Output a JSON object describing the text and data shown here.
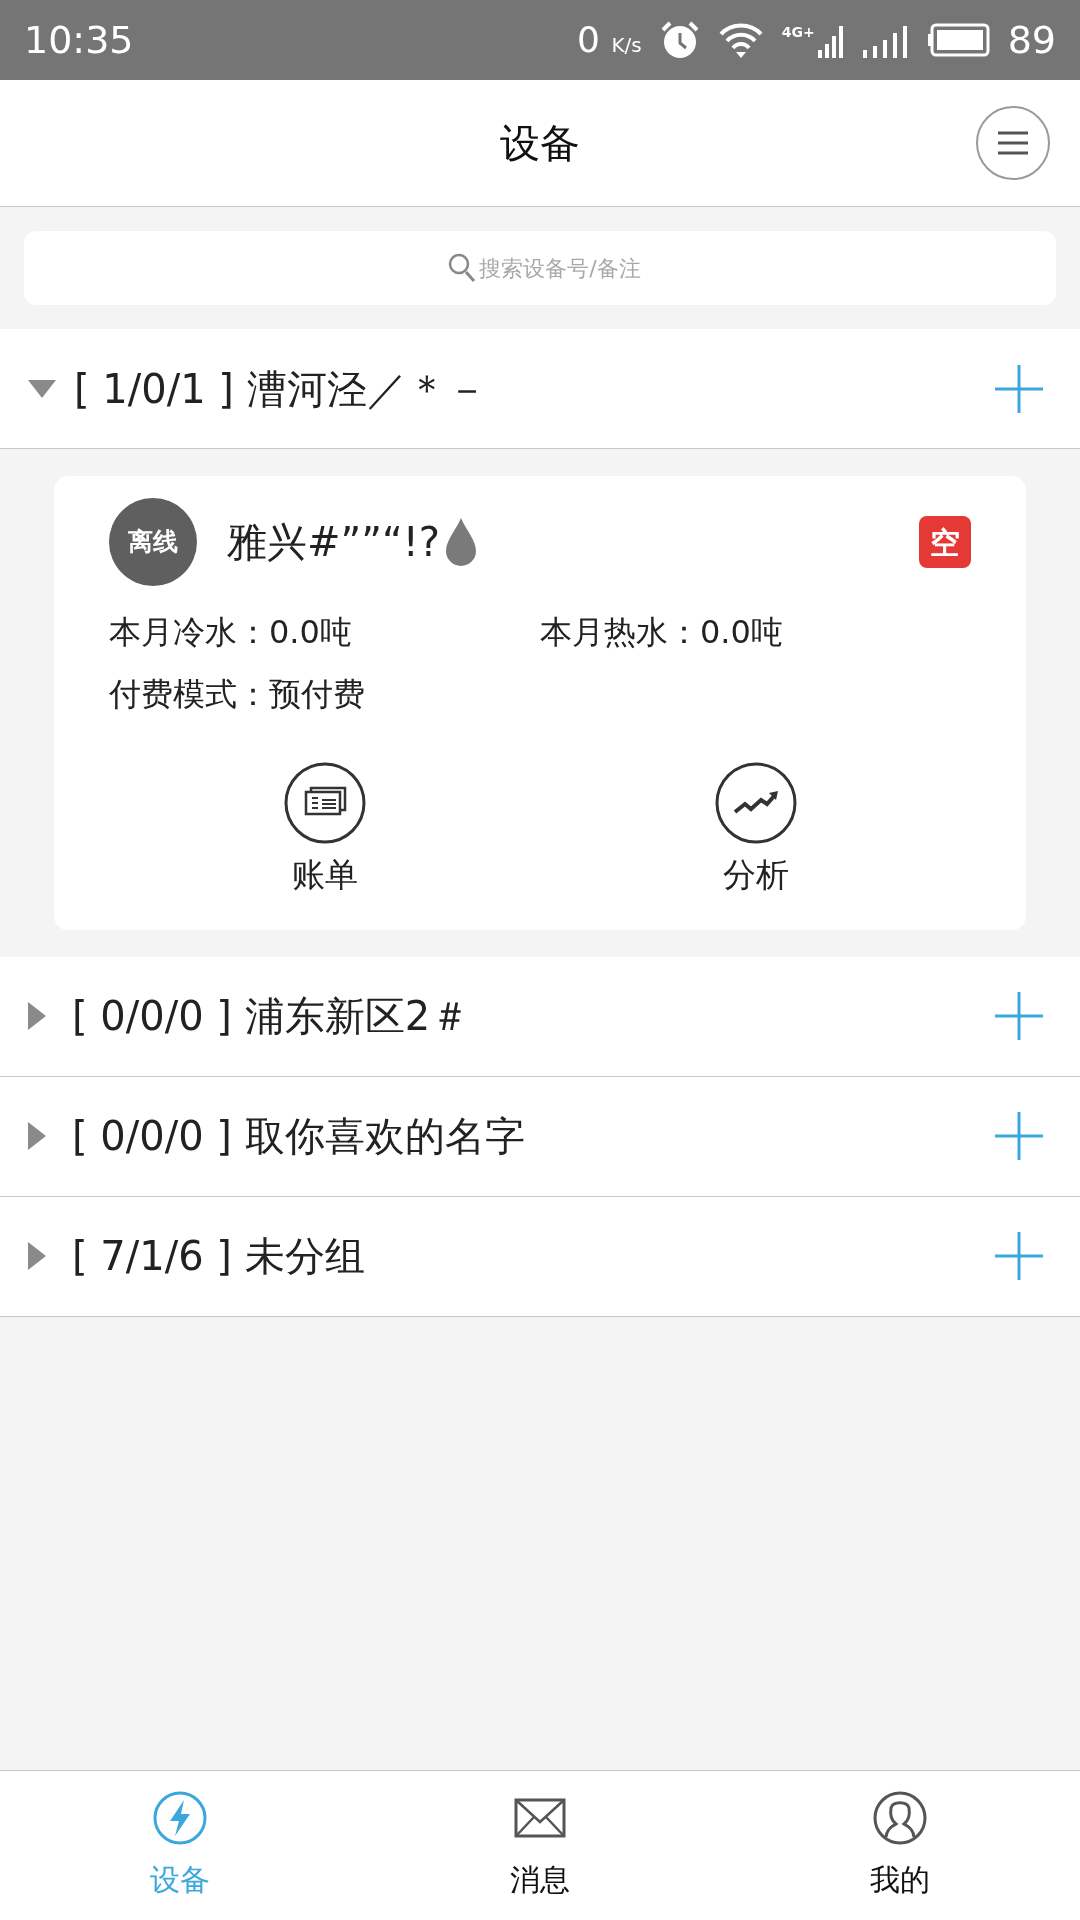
{
  "status_bar": {
    "time": "10:35",
    "speed": "0",
    "speed_unit": "K/s",
    "network": "4G+",
    "battery": "89"
  },
  "header": {
    "title": "设备"
  },
  "search": {
    "placeholder": "搜索设备号/备注"
  },
  "groups": [
    {
      "label": "[ 1/0/1 ] 漕河泾／＊－",
      "expanded": true,
      "devices": [
        {
          "status": "离线",
          "name": "雅兴#””“!?",
          "tag": "空",
          "info": [
            [
              "本月冷水：0.0吨",
              "本月热水：0.0吨"
            ],
            [
              "付费模式：预付费"
            ]
          ],
          "actions": [
            {
              "kind": "bill",
              "label": "账单"
            },
            {
              "kind": "analysis",
              "label": "分析"
            }
          ]
        }
      ]
    },
    {
      "label": "[ 0/0/0 ] 浦东新区2＃",
      "expanded": false
    },
    {
      "label": "[ 0/0/0 ] 取你喜欢的名字",
      "expanded": false
    },
    {
      "label": "[ 7/1/6 ] 未分组",
      "expanded": false
    }
  ],
  "nav": [
    {
      "kind": "devices",
      "label": "设备",
      "selected": true
    },
    {
      "kind": "messages",
      "label": "消息",
      "selected": false
    },
    {
      "kind": "me",
      "label": "我的",
      "selected": false
    }
  ]
}
